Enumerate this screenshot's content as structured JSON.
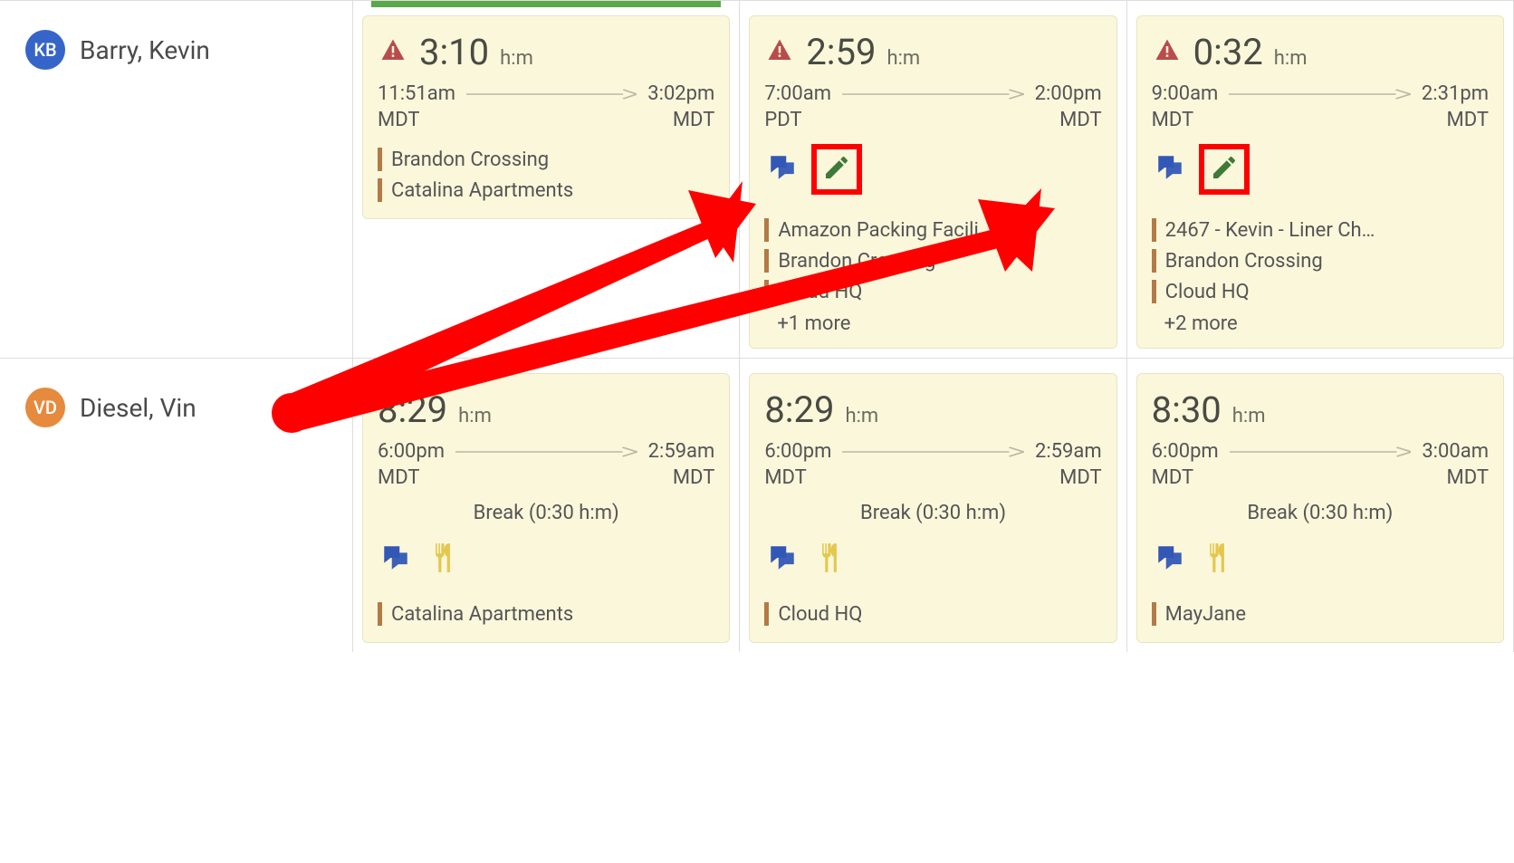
{
  "hm_label": "h:m",
  "rows": [
    {
      "avatar": "KB",
      "avatar_color": "blue",
      "name": "Barry, Kevin",
      "cells": [
        {
          "green_bar": true,
          "warn": true,
          "duration": "3:10",
          "start_time": "11:51am",
          "start_tz": "MDT",
          "end_time": "3:02pm",
          "end_tz": "MDT",
          "break": "",
          "chat": false,
          "pencil": false,
          "fork": false,
          "locations": [
            "Brandon Crossing",
            "Catalina Apartments"
          ],
          "more": ""
        },
        {
          "green_bar": false,
          "warn": true,
          "duration": "2:59",
          "start_time": "7:00am",
          "start_tz": "PDT",
          "end_time": "2:00pm",
          "end_tz": "MDT",
          "break": "",
          "chat": true,
          "pencil": true,
          "fork": false,
          "locations": [
            "Amazon Packing Facili…",
            "Brandon Crossing",
            "Cloud HQ"
          ],
          "more": "+1 more"
        },
        {
          "green_bar": false,
          "warn": true,
          "duration": "0:32",
          "start_time": "9:00am",
          "start_tz": "MDT",
          "end_time": "2:31pm",
          "end_tz": "MDT",
          "break": "",
          "chat": true,
          "pencil": true,
          "fork": false,
          "locations": [
            "2467 - Kevin - Liner Ch…",
            "Brandon Crossing",
            "Cloud HQ"
          ],
          "more": "+2 more"
        }
      ]
    },
    {
      "avatar": "VD",
      "avatar_color": "orange",
      "name": "Diesel, Vin",
      "cells": [
        {
          "green_bar": false,
          "warn": false,
          "duration": "8:29",
          "start_time": "6:00pm",
          "start_tz": "MDT",
          "end_time": "2:59am",
          "end_tz": "MDT",
          "break": "Break (0:30 h:m)",
          "chat": true,
          "pencil": false,
          "fork": true,
          "locations": [
            "Catalina Apartments"
          ],
          "more": ""
        },
        {
          "green_bar": false,
          "warn": false,
          "duration": "8:29",
          "start_time": "6:00pm",
          "start_tz": "MDT",
          "end_time": "2:59am",
          "end_tz": "MDT",
          "break": "Break (0:30 h:m)",
          "chat": true,
          "pencil": false,
          "fork": true,
          "locations": [
            "Cloud HQ"
          ],
          "more": ""
        },
        {
          "green_bar": false,
          "warn": false,
          "duration": "8:30",
          "start_time": "6:00pm",
          "start_tz": "MDT",
          "end_time": "3:00am",
          "end_tz": "MDT",
          "break": "Break (0:30 h:m)",
          "chat": true,
          "pencil": false,
          "fork": true,
          "locations": [
            "MayJane"
          ],
          "more": ""
        }
      ]
    }
  ]
}
